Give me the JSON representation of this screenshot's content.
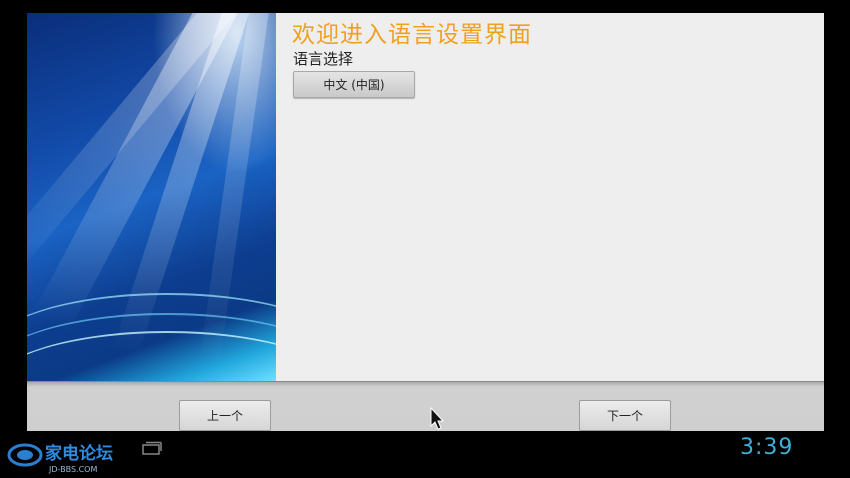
{
  "main": {
    "title": "欢迎进入语言设置界面",
    "section_label": "语言选择",
    "selected_language": "中文 (中国)"
  },
  "navigation": {
    "prev_label": "上一个",
    "next_label": "下一个"
  },
  "status_bar": {
    "time": "3:39",
    "icons": [
      "home-icon",
      "recent-apps-icon"
    ]
  },
  "watermark": {
    "text": "家电论坛",
    "subtext": "JD-BBS.COM"
  },
  "colors": {
    "title": "#f0a020",
    "clock": "#3fb0d8",
    "panel_bg": "#eeeeee"
  }
}
